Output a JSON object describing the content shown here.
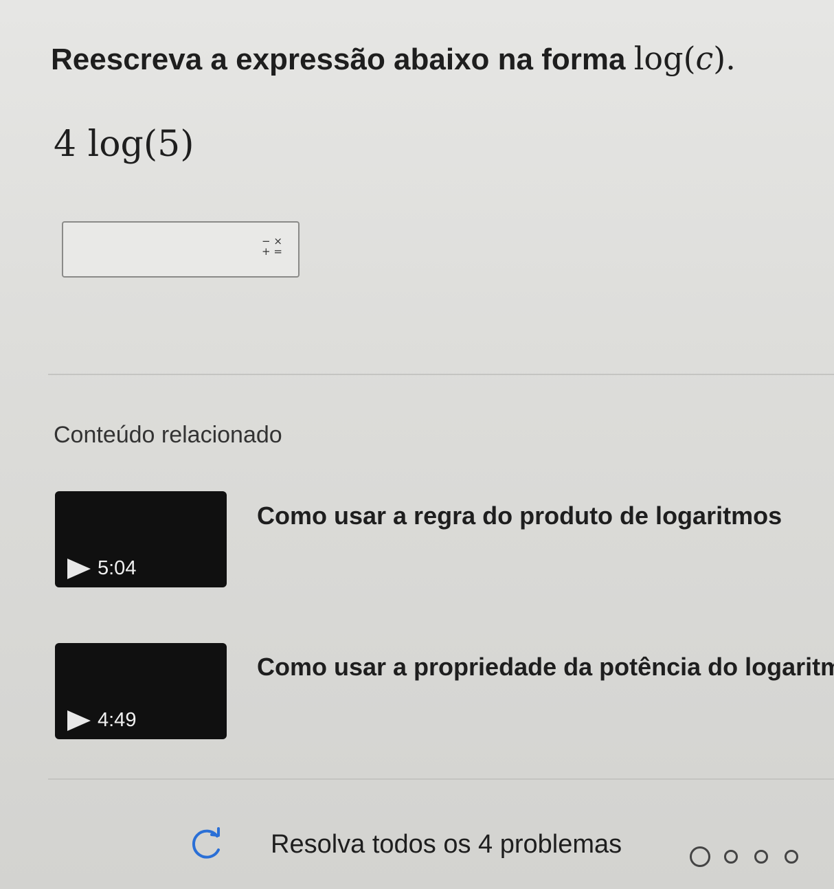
{
  "question": {
    "prompt": "Reescreva a expressão abaixo na forma",
    "target_form_fn": "log(",
    "target_form_var": "c",
    "target_form_close": ")."
  },
  "expression": "4 log(5)",
  "answer": {
    "value": "",
    "placeholder": "",
    "keypad_top": "− ×",
    "keypad_bottom": "+ ="
  },
  "related": {
    "heading": "Conteúdo relacionado",
    "videos": [
      {
        "title": "Como usar a regra do produto de logaritmos",
        "duration": "5:04"
      },
      {
        "title": "Como usar a propriedade da potência do logaritmo",
        "duration": "4:49"
      }
    ]
  },
  "footer": {
    "text": "Resolva todos os 4 problemas",
    "progress_total": 4,
    "progress_completed": 0
  },
  "colors": {
    "background": "#dcdcd9",
    "thumbnail": "#101010",
    "text": "#1e1e1e"
  },
  "icons": [
    "math-keypad-icon",
    "play-icon",
    "refresh-icon"
  ]
}
